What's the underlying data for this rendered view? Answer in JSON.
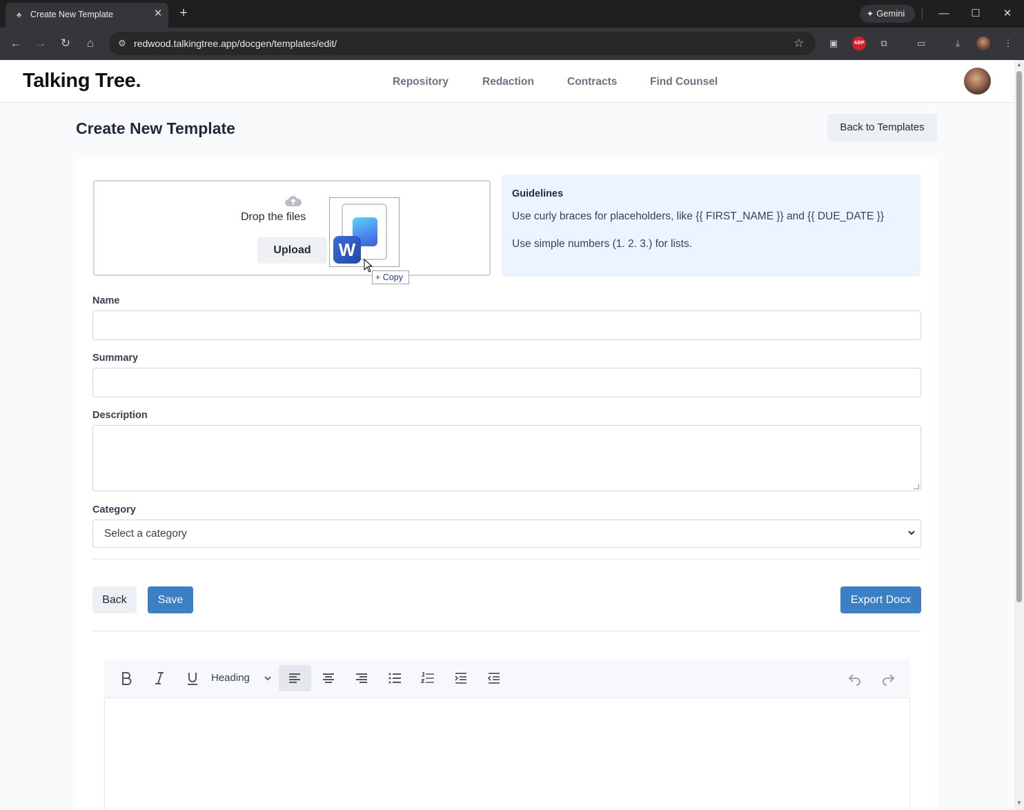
{
  "browser": {
    "tab_title": "Create New Template",
    "url": "redwood.talkingtree.app/docgen/templates/edit/",
    "gemini_label": "Gemini"
  },
  "site": {
    "logo": "Talking Tree.",
    "nav": [
      "Repository",
      "Redaction",
      "Contracts",
      "Find Counsel"
    ]
  },
  "page": {
    "title": "Create New Template",
    "back_to_templates": "Back to Templates"
  },
  "upload": {
    "drop_text": "Drop the files",
    "upload_label": "Upload",
    "drag_badge": "W",
    "copy_tooltip": "+ Copy"
  },
  "guidelines": {
    "title": "Guidelines",
    "lines": [
      "Use curly braces for placeholders, like {{ FIRST_NAME }} and {{ DUE_DATE }}",
      "Use simple numbers (1. 2. 3.) for lists."
    ]
  },
  "form": {
    "name_label": "Name",
    "name_value": "",
    "summary_label": "Summary",
    "summary_value": "",
    "description_label": "Description",
    "description_value": "",
    "category_label": "Category",
    "category_selected": "Select a category"
  },
  "actions": {
    "back": "Back",
    "save": "Save",
    "export": "Export Docx"
  },
  "editor": {
    "heading_select": "Heading",
    "tools": [
      "bold-icon",
      "italic-icon",
      "underline-icon",
      "align-left-icon",
      "align-center-icon",
      "align-right-icon",
      "bullet-list-icon",
      "numbered-list-icon",
      "indent-icon",
      "outdent-icon",
      "undo-icon",
      "redo-icon"
    ]
  },
  "colors": {
    "primary": "#3b7fc4",
    "guidelines_bg": "#eef4ff",
    "page_bg": "#f8fafc"
  }
}
